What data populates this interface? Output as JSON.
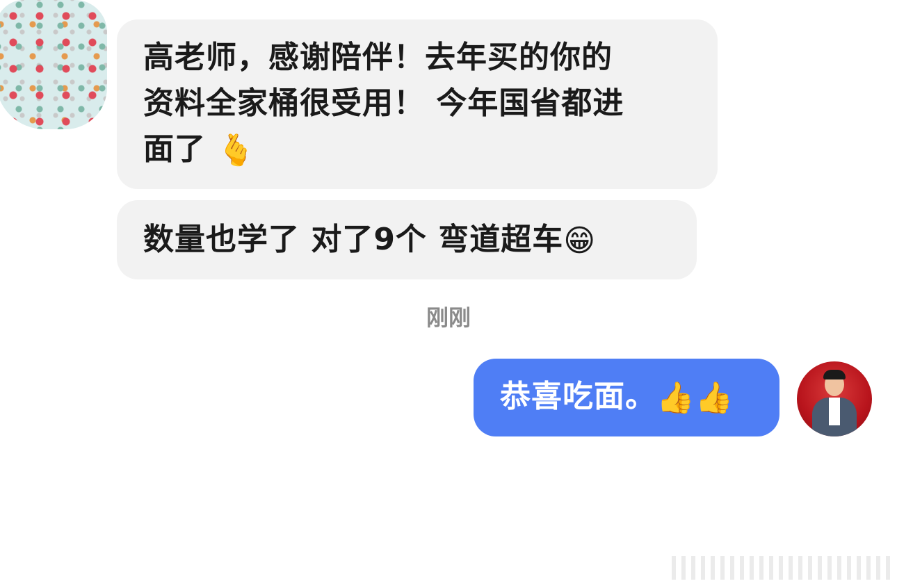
{
  "messages": {
    "incoming": [
      {
        "line1": "高老师，感谢陪伴！去年买的你的",
        "line2": "资料全家桶很受用！ 今年国省都进",
        "line3": "面了",
        "emoji": "🫰"
      },
      {
        "text": "数量也学了 对了9个 弯道超车",
        "emoji": "😁"
      }
    ],
    "timestamp": "刚刚",
    "outgoing": [
      {
        "text": "恭喜吃面。",
        "emoji": "👍👍"
      }
    ]
  },
  "colors": {
    "incoming_bubble": "#f2f2f2",
    "outgoing_bubble": "#4f7ef5",
    "text_dark": "#1a1a1a",
    "timestamp": "#8a8a8a"
  },
  "icons": {
    "left_avatar": "obscured-avatar",
    "right_avatar": "teacher-avatar"
  }
}
